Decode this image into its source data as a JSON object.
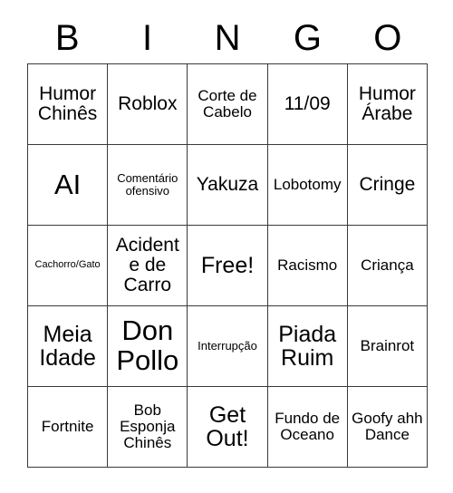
{
  "card": {
    "headers": [
      "B",
      "I",
      "N",
      "G",
      "O"
    ],
    "rows": [
      [
        {
          "text": "Humor Chinês",
          "size": "fs-md"
        },
        {
          "text": "Roblox",
          "size": "fs-md"
        },
        {
          "text": "Corte de Cabelo",
          "size": "fs-sm"
        },
        {
          "text": "11/09",
          "size": "fs-md"
        },
        {
          "text": "Humor Árabe",
          "size": "fs-md"
        }
      ],
      [
        {
          "text": "AI",
          "size": "fs-xl"
        },
        {
          "text": "Comentário ofensivo",
          "size": "fs-xs"
        },
        {
          "text": "Yakuza",
          "size": "fs-md"
        },
        {
          "text": "Lobotomy",
          "size": "fs-sm"
        },
        {
          "text": "Cringe",
          "size": "fs-md"
        }
      ],
      [
        {
          "text": "Cachorro/Gato",
          "size": "fs-xxs"
        },
        {
          "text": "Acidente de Carro",
          "size": "fs-md"
        },
        {
          "text": "Free!",
          "size": "fs-lg"
        },
        {
          "text": "Racismo",
          "size": "fs-sm"
        },
        {
          "text": "Criança",
          "size": "fs-sm"
        }
      ],
      [
        {
          "text": "Meia Idade",
          "size": "fs-lg"
        },
        {
          "text": "Don Pollo",
          "size": "fs-xl"
        },
        {
          "text": "Interrupção",
          "size": "fs-xs"
        },
        {
          "text": "Piada Ruim",
          "size": "fs-lg"
        },
        {
          "text": "Brainrot",
          "size": "fs-sm"
        }
      ],
      [
        {
          "text": "Fortnite",
          "size": "fs-sm"
        },
        {
          "text": "Bob Esponja Chinês",
          "size": "fs-sm"
        },
        {
          "text": "Get Out!",
          "size": "fs-lg"
        },
        {
          "text": "Fundo de Oceano",
          "size": "fs-sm"
        },
        {
          "text": "Goofy ahh Dance",
          "size": "fs-sm"
        }
      ]
    ],
    "colors": {
      "text": "#000000",
      "border": "#3a3a3a",
      "background": "#ffffff"
    }
  }
}
